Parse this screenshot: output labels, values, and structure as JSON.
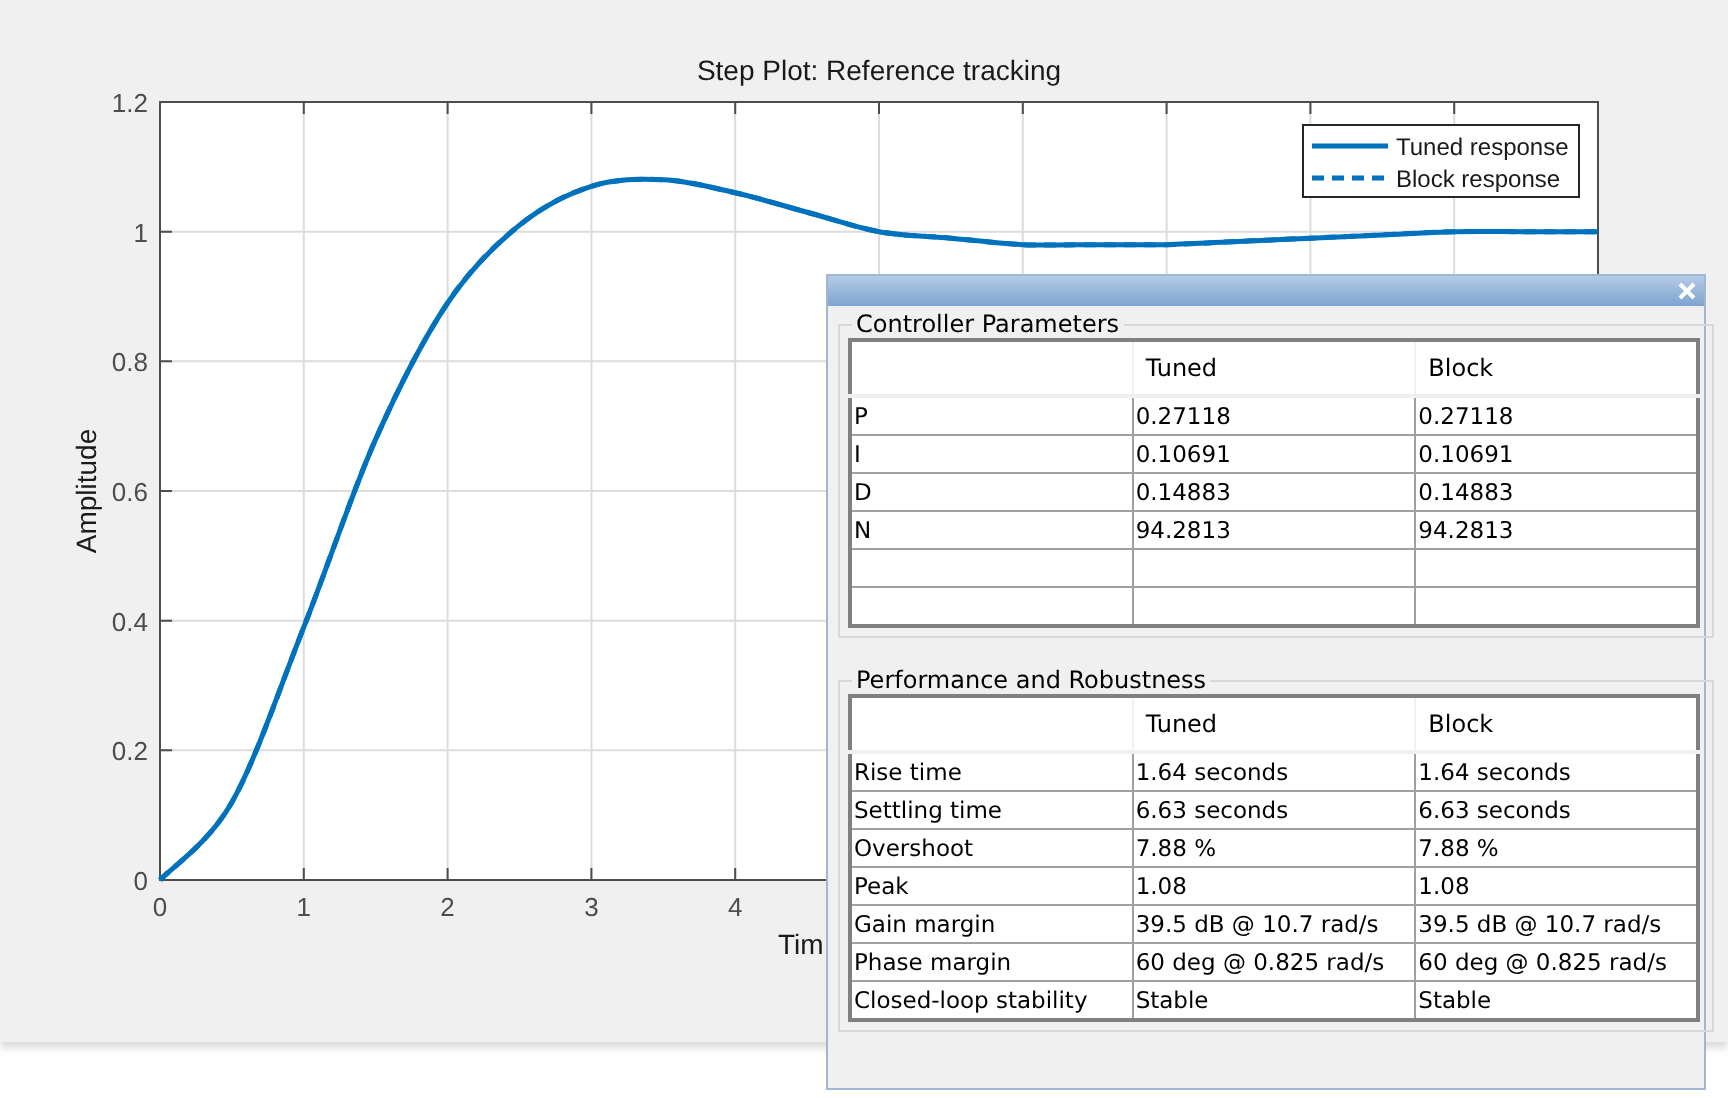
{
  "plot": {
    "chart_data": {
      "type": "line",
      "title": "Step Plot: Reference tracking",
      "xlabel": "Tim",
      "ylabel": "Amplitude",
      "x": [
        0,
        0.5,
        1,
        1.5,
        2,
        2.5,
        3,
        3.5,
        4,
        4.5,
        5,
        5.5,
        6,
        6.5,
        7,
        7.5,
        8,
        8.5,
        9,
        9.5,
        10
      ],
      "series": [
        {
          "name": "Tuned response",
          "color": "#0072bd",
          "line_style": "solid",
          "values": [
            0,
            0.12,
            0.39,
            0.68,
            0.89,
            1.01,
            1.07,
            1.08,
            1.06,
            1.03,
            1.0,
            0.99,
            0.98,
            0.98,
            0.98,
            0.985,
            0.99,
            0.995,
            1.0,
            1.0,
            1.0
          ]
        },
        {
          "name": "Block response",
          "color": "#0072bd",
          "line_style": "dashed",
          "values": [
            0,
            0.12,
            0.39,
            0.68,
            0.89,
            1.01,
            1.07,
            1.08,
            1.06,
            1.03,
            1.0,
            0.99,
            0.98,
            0.98,
            0.98,
            0.985,
            0.99,
            0.995,
            1.0,
            1.0,
            1.0
          ]
        }
      ],
      "xlim": [
        0,
        10
      ],
      "ylim": [
        0,
        1.2
      ],
      "xticks": [
        0,
        1,
        2,
        3,
        4
      ],
      "yticks": [
        0,
        0.2,
        0.4,
        0.6,
        0.8,
        1,
        1.2
      ],
      "grid": true,
      "legend": true
    }
  },
  "dialog": {
    "groups": [
      {
        "title": "Controller Parameters",
        "columns": [
          "",
          "Tuned",
          "Block"
        ],
        "rows": [
          {
            "kind": "data",
            "cells": [
              "P",
              "0.27118",
              "0.27118"
            ]
          },
          {
            "kind": "data",
            "cells": [
              "I",
              "0.10691",
              "0.10691"
            ]
          },
          {
            "kind": "data",
            "cells": [
              "D",
              "0.14883",
              "0.14883"
            ]
          },
          {
            "kind": "data",
            "cells": [
              "N",
              "94.2813",
              "94.2813"
            ]
          },
          {
            "kind": "blank"
          },
          {
            "kind": "blank"
          }
        ]
      },
      {
        "title": "Performance and Robustness",
        "columns": [
          "",
          "Tuned",
          "Block"
        ],
        "rows": [
          {
            "kind": "data",
            "cells": [
              "Rise time",
              "1.64 seconds",
              "1.64 seconds"
            ]
          },
          {
            "kind": "data",
            "cells": [
              "Settling time",
              "6.63 seconds",
              "6.63 seconds"
            ]
          },
          {
            "kind": "data",
            "cells": [
              "Overshoot",
              "7.88 %",
              "7.88 %"
            ]
          },
          {
            "kind": "data",
            "cells": [
              "Peak",
              "1.08",
              "1.08"
            ]
          },
          {
            "kind": "data",
            "cells": [
              "Gain margin",
              "39.5 dB @ 10.7 rad/s",
              "39.5 dB @ 10.7 rad/s"
            ]
          },
          {
            "kind": "data",
            "cells": [
              "Phase margin",
              "60 deg @ 0.825 rad/s",
              "60 deg @ 0.825 rad/s"
            ]
          },
          {
            "kind": "data",
            "cells": [
              "Closed-loop stability",
              "Stable",
              "Stable"
            ]
          }
        ]
      }
    ]
  }
}
